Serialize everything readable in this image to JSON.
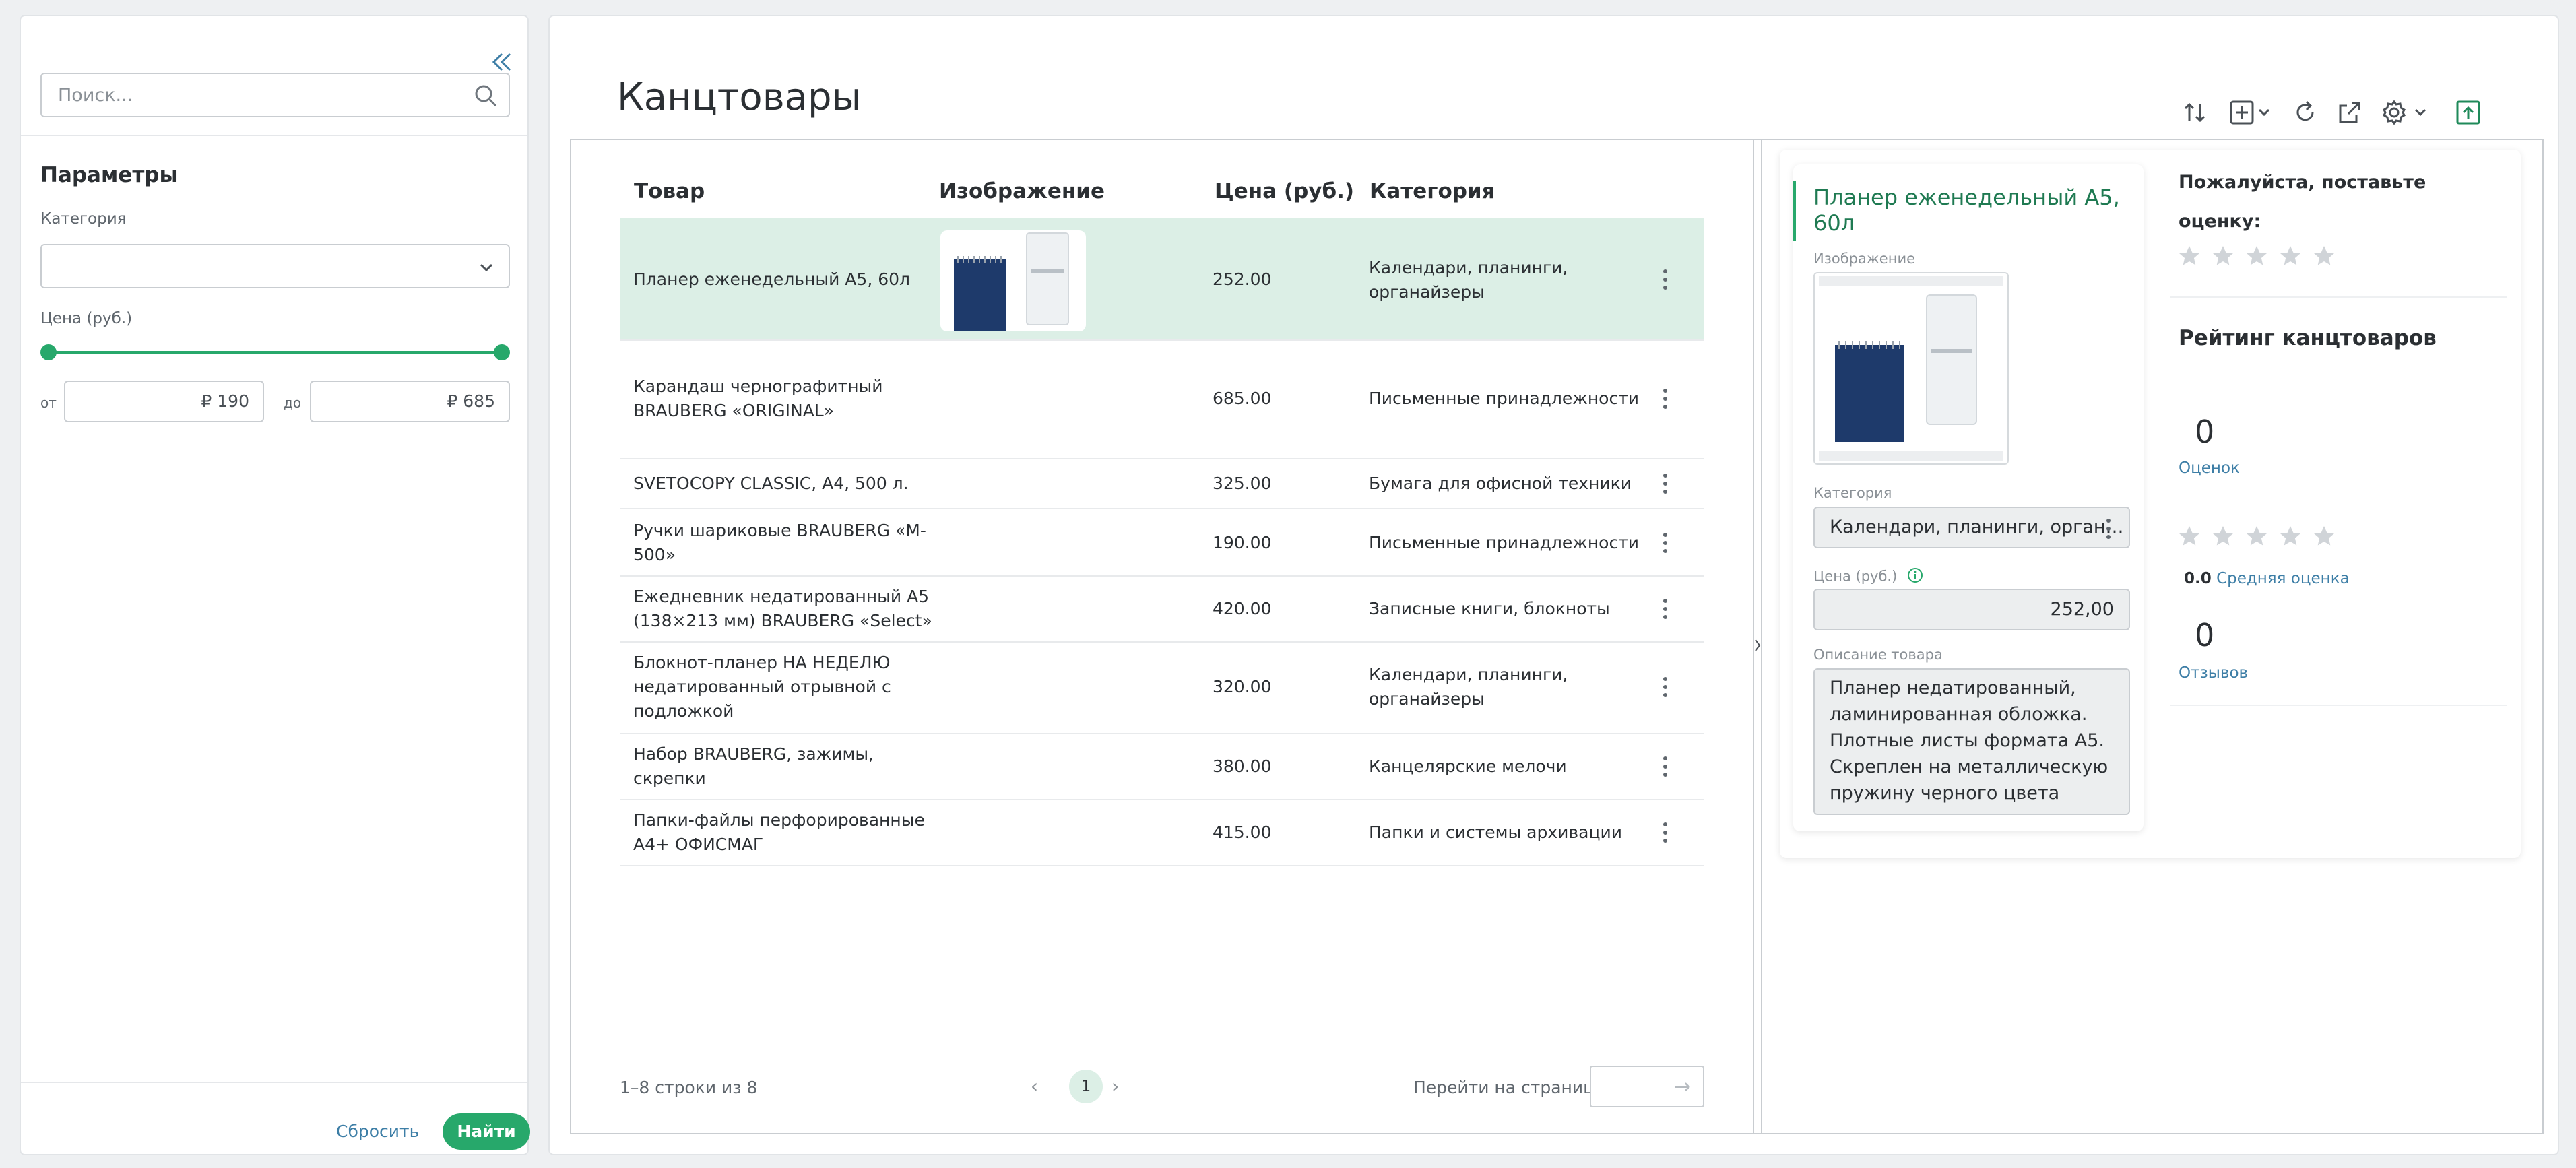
{
  "filters": {
    "search_placeholder": "Поиск...",
    "params_title": "Параметры",
    "category_label": "Категория",
    "category_value": "",
    "price_label": "Цена (руб.)",
    "from_prefix": "от",
    "to_prefix": "до",
    "from_value": "₽ 190",
    "to_value": "₽ 685",
    "reset_label": "Сбросить",
    "find_label": "Найти"
  },
  "main": {
    "title": "Канцтовары",
    "toolbar_icons": [
      "sort-icon",
      "add-icon",
      "refresh-icon",
      "export-icon",
      "settings-icon",
      "upload-icon"
    ]
  },
  "table": {
    "columns": [
      "Товар",
      "Изображение",
      "Цена (руб.)",
      "Категория"
    ],
    "rows": [
      {
        "name": [
          "Планер еженедельный А5, 60л"
        ],
        "price": "252.00",
        "category": [
          "Календари, планинги,",
          "органайзеры"
        ]
      },
      {
        "name": [
          "Карандаш чернографитный",
          "BRAUBERG «ORIGINAL»"
        ],
        "price": "685.00",
        "category": [
          "Письменные принадлежности"
        ]
      },
      {
        "name": [
          "SVETOCOPY CLASSIC, А4, 500 л."
        ],
        "price": "325.00",
        "category": [
          "Бумага для офисной техники"
        ]
      },
      {
        "name": [
          "Ручки шариковые BRAUBERG «M-",
          "500»"
        ],
        "price": "190.00",
        "category": [
          "Письменные принадлежности"
        ]
      },
      {
        "name": [
          "Ежедневник недатированный А5",
          "(138×213 мм) BRAUBERG «Select»"
        ],
        "price": "420.00",
        "category": [
          "Записные книги, блокноты"
        ]
      },
      {
        "name": [
          "Блокнот-планер НА НЕДЕЛЮ",
          "недатированный отрывной с",
          "подложкой"
        ],
        "price": "320.00",
        "category": [
          "Календари, планинги,",
          "органайзеры"
        ]
      },
      {
        "name": [
          "Набор BRAUBERG, зажимы,",
          "скрепки"
        ],
        "price": "380.00",
        "category": [
          "Канцелярские мелочи"
        ]
      },
      {
        "name": [
          "Папки-файлы перфорированные",
          "А4+ ОФИСМАГ"
        ],
        "price": "415.00",
        "category": [
          "Папки и системы архивации"
        ]
      }
    ]
  },
  "pager": {
    "summary": "1–8 строки из 8",
    "page": "1",
    "goto_label": "Перейти на страницу"
  },
  "details": {
    "title": "Планер еженедельный А5, 60л",
    "image_label": "Изображение",
    "category_label": "Категория",
    "category_value": "Календари, планинги, орган…",
    "price_label": "Цена (руб.)",
    "price_value": "252,00",
    "description_label": "Описание товара",
    "description_value": "Планер недатированный, ламинированная обложка. Плотные листы формата А5. Скреплен на металлическую пружину черного цвета"
  },
  "rating": {
    "prompt": "Пожалуйста, поставьте оценку:",
    "title": "Рейтинг канцтоваров",
    "ratings_count": "0",
    "ratings_label": "Оценок",
    "average_value": "0.0",
    "average_label": "Средняя оценка",
    "reviews_count": "0",
    "reviews_label": "Отзывов"
  },
  "colors": {
    "accent": "#27a86b",
    "selected_row": "#dcefe6",
    "link": "#3d7ea6"
  }
}
